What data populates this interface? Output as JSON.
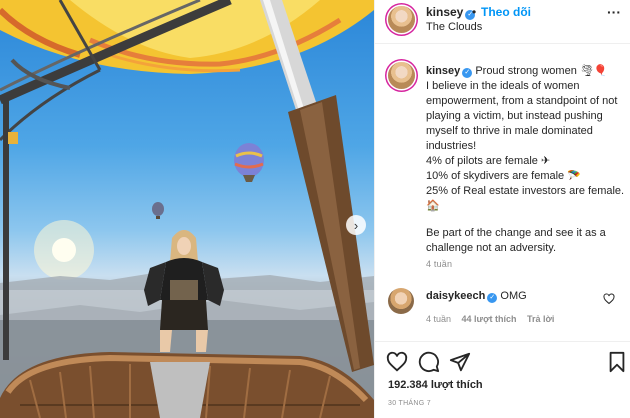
{
  "post": {
    "username": "kinsey",
    "follow_label": "Theo dõi",
    "dot": "•",
    "location": "The Clouds",
    "more_label": "···",
    "next_label": "›"
  },
  "caption": {
    "username": "kinsey",
    "lines": [
      "Proud strong women 🌪🎈",
      "I believe in the ideals of women empowerment, from a standpoint of not playing a victim, but instead pushing myself to thrive in male dominated industries!",
      "4% of pilots are female ✈",
      "10% of skydivers are female 🪂",
      "25% of Real estate investors are female. 🏠",
      "Be part of the change and see it as a challenge not an adversity."
    ],
    "time": "4 tuần"
  },
  "comment": {
    "username": "daisykeech",
    "text": "OMG",
    "time": "4 tuần",
    "likes": "44 lượt thích",
    "reply": "Trả lời"
  },
  "footer": {
    "likes": "192.384 lượt thích",
    "date": "30 THÁNG 7"
  },
  "icons": {
    "verified": "verified-badge-icon",
    "like": "heart-icon",
    "comment": "comment-icon",
    "share": "paper-plane-icon",
    "save": "bookmark-icon"
  },
  "colors": {
    "link": "#0095f6",
    "verified": "#3897f0",
    "muted": "#8e8e8e",
    "text": "#262626"
  }
}
